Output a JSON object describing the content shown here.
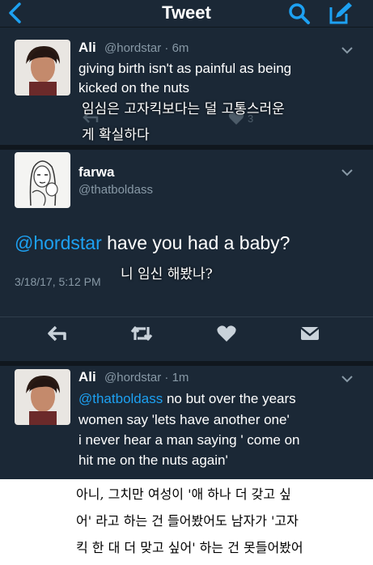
{
  "nav": {
    "title": "Tweet"
  },
  "tweet1": {
    "name": "Ali",
    "handle": "@hordstar · 6m",
    "line1": "giving birth isn't as painful as being",
    "line2": "kicked on the nuts",
    "reply_count_partial": "3",
    "caption_line1": "임심은 고자킥보다는 덜 고통스러운",
    "caption_line2": "게 확실하다"
  },
  "tweet2": {
    "name": "farwa",
    "handle": "@thatboldass",
    "mention": "@hordstar",
    "text": " have you had a baby?",
    "date": "3/18/17, 5:12 PM",
    "caption": "니 임신 해봤나?"
  },
  "tweet3": {
    "name": "Ali",
    "handle": "@hordstar · 1m",
    "mention": "@thatboldass",
    "line1_rest": " no but over the years",
    "line2": "women say 'lets have another one'",
    "line3": "i never hear a man saying ' come on",
    "line4": "hit me on the nuts again'"
  },
  "bottom_caption": {
    "line1": "아니, 그치만 여성이 '애 하나 더 갖고 싶",
    "line2": "어' 라고 하는 건 들어봤어도 남자가 '고자",
    "line3": "킥 한 대 더 맞고 싶어' 하는 건 못들어봤어"
  },
  "colors": {
    "background": "#1b2836",
    "link": "#1da1f2",
    "secondary_text": "#8899a6",
    "icon": "#c9d2da"
  },
  "icons": [
    "back-arrow-icon",
    "search-icon",
    "compose-icon",
    "chevron-down-icon",
    "reply-icon",
    "retweet-icon",
    "like-icon",
    "dm-icon"
  ]
}
